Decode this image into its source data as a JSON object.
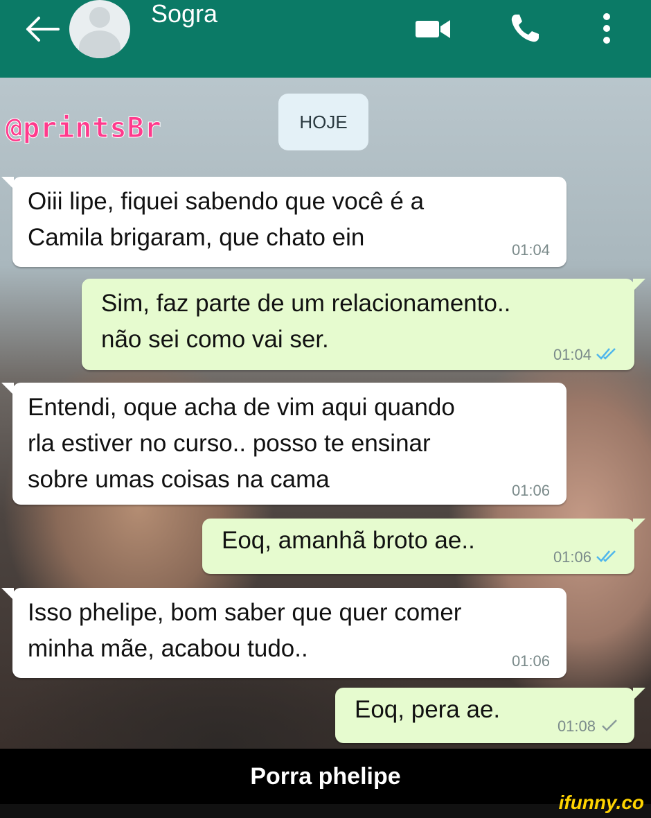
{
  "header": {
    "contact_name": "Sogra",
    "icons": [
      "back-arrow-icon",
      "avatar",
      "video-camera-icon",
      "phone-icon",
      "more-vertical-icon"
    ],
    "color": "#0b7a66"
  },
  "chat": {
    "watermark": "@printsBr",
    "date_chip": "HOJE",
    "messages": [
      {
        "dir": "in",
        "text": "Oiii lipe, fiquei sabendo que você é a\nCamila brigaram, que chato ein",
        "time": "01:04"
      },
      {
        "dir": "out",
        "text": "Sim, faz parte de um relacionamento..\nnão sei como vai ser.",
        "time": "01:04",
        "status": "read"
      },
      {
        "dir": "in",
        "text": "Entendi, oque acha de vim aqui quando\nrla estiver no curso.. posso te ensinar\nsobre umas coisas na cama",
        "time": "01:06"
      },
      {
        "dir": "out",
        "text": "Eoq, amanhã broto ae..",
        "time": "01:06",
        "status": "read"
      },
      {
        "dir": "in",
        "text": "Isso phelipe, bom saber que quer comer\nminha mãe, acabou tudo..",
        "time": "01:06"
      },
      {
        "dir": "out",
        "text": "Eoq, pera ae.",
        "time": "01:08",
        "status": "sent"
      }
    ],
    "colors": {
      "incoming": "#ffffff",
      "outgoing": "#e6fbcf",
      "read_tick": "#4fb6ec",
      "sent_tick": "#8a9a9a"
    }
  },
  "caption": "Porra phelipe",
  "brand": "ifunny.co"
}
